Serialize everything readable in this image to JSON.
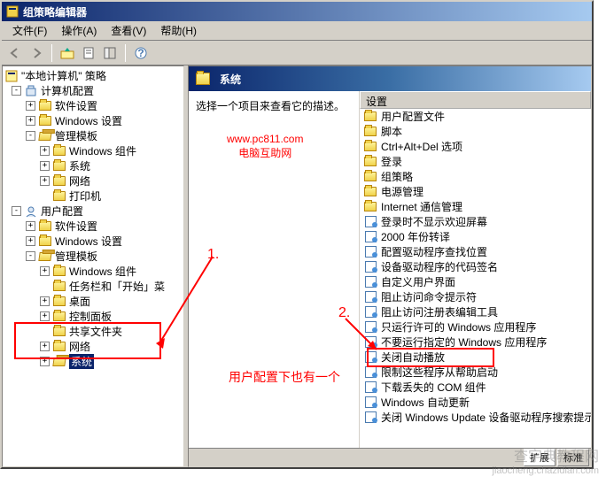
{
  "window": {
    "title": "组策略编辑器"
  },
  "menu": {
    "file": "文件(F)",
    "action": "操作(A)",
    "view": "查看(V)",
    "help": "帮助(H)"
  },
  "tree": {
    "root": "\"本地计算机\" 策略",
    "computer": "计算机配置",
    "c_software": "软件设置",
    "c_windows": "Windows 设置",
    "c_admin": "管理模板",
    "c_win_comp": "Windows 组件",
    "c_system": "系统",
    "c_network": "网络",
    "c_printer": "打印机",
    "user": "用户配置",
    "u_software": "软件设置",
    "u_windows": "Windows 设置",
    "u_admin": "管理模板",
    "u_win_comp": "Windows 组件",
    "u_taskbar": "任务栏和「开始」菜",
    "u_desktop": "桌面",
    "u_control": "控制面板",
    "u_shared": "共享文件夹",
    "u_network": "网络",
    "u_system": "系统"
  },
  "right": {
    "title": "系统",
    "desc": "选择一个项目来查看它的描述。",
    "col_header": "设置",
    "items": [
      {
        "type": "folder",
        "label": "用户配置文件"
      },
      {
        "type": "folder",
        "label": "脚本"
      },
      {
        "type": "folder",
        "label": "Ctrl+Alt+Del 选项"
      },
      {
        "type": "folder",
        "label": "登录"
      },
      {
        "type": "folder",
        "label": "组策略"
      },
      {
        "type": "folder",
        "label": "电源管理"
      },
      {
        "type": "folder",
        "label": "Internet 通信管理"
      },
      {
        "type": "setting",
        "label": "登录时不显示欢迎屏幕"
      },
      {
        "type": "setting",
        "label": "2000 年份转译"
      },
      {
        "type": "setting",
        "label": "配置驱动程序查找位置"
      },
      {
        "type": "setting",
        "label": "设备驱动程序的代码签名"
      },
      {
        "type": "setting",
        "label": "自定义用户界面"
      },
      {
        "type": "setting",
        "label": "阻止访问命令提示符"
      },
      {
        "type": "setting",
        "label": "阻止访问注册表编辑工具"
      },
      {
        "type": "setting",
        "label": "只运行许可的 Windows 应用程序"
      },
      {
        "type": "setting",
        "label": "不要运行指定的 Windows 应用程序"
      },
      {
        "type": "setting",
        "label": "关闭自动播放"
      },
      {
        "type": "setting",
        "label": "限制这些程序从帮助启动"
      },
      {
        "type": "setting",
        "label": "下载丢失的 COM 组件"
      },
      {
        "type": "setting",
        "label": "Windows 自动更新"
      },
      {
        "type": "setting",
        "label": "关闭 Windows Update 设备驱动程序搜索提示"
      }
    ]
  },
  "tabs": {
    "extended": "扩展",
    "standard": "标准"
  },
  "annotations": {
    "num1": "1.",
    "num2": "2.",
    "note": "用户配置下也有一个",
    "wm1": "www.pc811.com",
    "wm2": "电脑互助网",
    "wm3": "查字典教程网",
    "wm4": "jiaocheng.chazidian.com"
  }
}
